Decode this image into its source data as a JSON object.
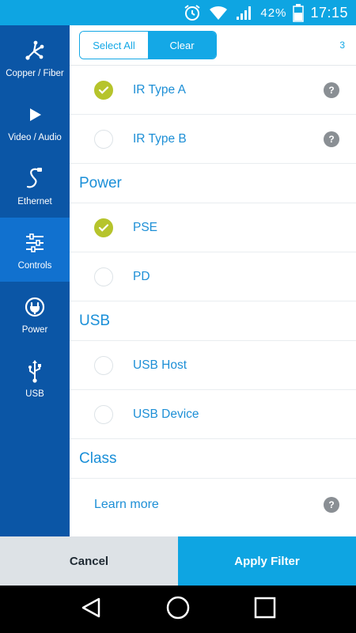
{
  "status_bar": {
    "battery_percent": "42%",
    "time": "17:15",
    "background": "#0ea5e2"
  },
  "sidebar": {
    "items": [
      {
        "label": "Copper / Fiber",
        "icon": "fiber-icon",
        "active": false
      },
      {
        "label": "Video / Audio",
        "icon": "play-icon",
        "active": false
      },
      {
        "label": "Ethernet",
        "icon": "cable-icon",
        "active": false
      },
      {
        "label": "Controls",
        "icon": "sliders-icon",
        "active": true
      },
      {
        "label": "Power",
        "icon": "plug-icon",
        "active": false
      },
      {
        "label": "USB",
        "icon": "usb-icon",
        "active": false
      }
    ]
  },
  "toolbar": {
    "select_all_label": "Select All",
    "clear_label": "Clear",
    "count": "3"
  },
  "list": {
    "ir_type_a": {
      "label": "IR Type A",
      "checked": true,
      "help": "?"
    },
    "ir_type_b": {
      "label": "IR Type B",
      "checked": false,
      "help": "?"
    },
    "power_header": "Power",
    "pse": {
      "label": "PSE",
      "checked": true
    },
    "pd": {
      "label": "PD",
      "checked": false
    },
    "usb_header": "USB",
    "usb_host": {
      "label": "USB Host",
      "checked": false
    },
    "usb_device": {
      "label": "USB Device",
      "checked": false
    },
    "class_header": "Class",
    "learn_more": {
      "label": "Learn more",
      "help": "?"
    }
  },
  "footer": {
    "cancel_label": "Cancel",
    "apply_label": "Apply Filter"
  },
  "colors": {
    "accent": "#14a8e6",
    "sidebar": "#0b56a6",
    "sidebar_active": "#1171cf",
    "check_on": "#b6c42c"
  }
}
